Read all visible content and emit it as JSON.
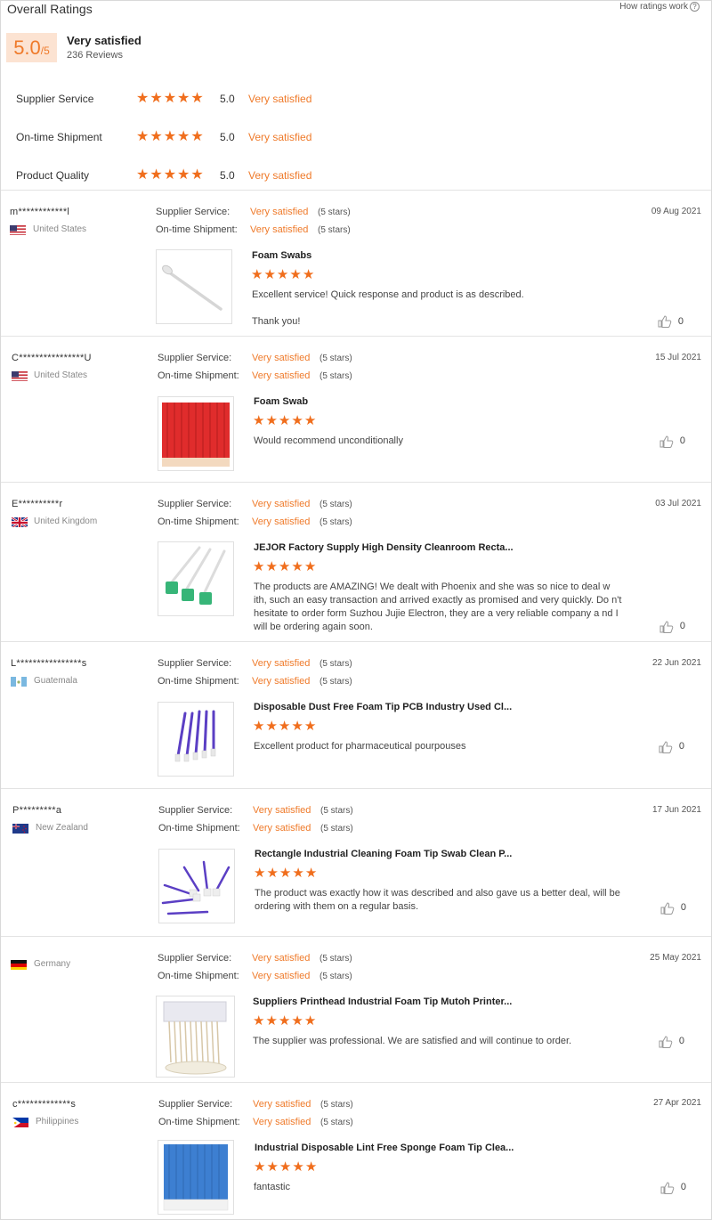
{
  "header": {
    "title": "Overall Ratings",
    "how_link": "How ratings work",
    "how_icon": "help-circle-icon",
    "score": "5.0",
    "score_max": "/5",
    "overall_label": "Very satisfied",
    "review_count": "236 Reviews"
  },
  "categories": [
    {
      "name": "Supplier Service",
      "rating": 5,
      "score": "5.0",
      "label": "Very satisfied"
    },
    {
      "name": "On-time Shipment",
      "rating": 5,
      "score": "5.0",
      "label": "Very satisfied"
    },
    {
      "name": "Product Quality",
      "rating": 5,
      "score": "5.0",
      "label": "Very satisfied"
    }
  ],
  "labels": {
    "supplier_service": "Supplier Service:",
    "on_time_shipment": "On-time Shipment:"
  },
  "reviews": [
    {
      "name": "m************l",
      "country": "United States",
      "flag": "us-flag-icon",
      "date": "09 Aug 2021",
      "supplier_value": "Very satisfied",
      "supplier_stars": "(5 stars)",
      "ontime_value": "Very satisfied",
      "ontime_stars": "(5 stars)",
      "product_title": "Foam Swabs",
      "rating": 5,
      "comment": "Excellent service!  Quick response and product is as described.",
      "comment2": "Thank you!",
      "likes": "0",
      "thumb": "single-foam-swab-image"
    },
    {
      "name": "C****************U",
      "country": "United States",
      "flag": "us-flag-icon",
      "date": "15 Jul 2021",
      "supplier_value": "Very satisfied",
      "supplier_stars": "(5 stars)",
      "ontime_value": "Very satisfied",
      "ontime_stars": "(5 stars)",
      "product_title": "Foam Swab",
      "rating": 5,
      "comment": "Would recommend unconditionally",
      "comment2": "",
      "likes": "0",
      "thumb": "red-swabs-bundle-image"
    },
    {
      "name": "E**********r",
      "country": "United Kingdom",
      "flag": "uk-flag-icon",
      "date": "03 Jul 2021",
      "supplier_value": "Very satisfied",
      "supplier_stars": "(5 stars)",
      "ontime_value": "Very satisfied",
      "ontime_stars": "(5 stars)",
      "product_title": "JEJOR Factory Supply High Density Cleanroom Recta...",
      "rating": 5,
      "comment": "The products are AMAZING! We dealt with Phoenix and she was so nice to deal w ith, such an easy transaction and arrived exactly as promised and very quickly. Do n't hesitate to order form Suzhou Jujie Electron, they are a very reliable company a nd I will be ordering again soon.",
      "comment2": "",
      "likes": "0",
      "thumb": "green-tip-swabs-image"
    },
    {
      "name": "L****************s",
      "country": "Guatemala",
      "flag": "guatemala-flag-icon",
      "date": "22 Jun 2021",
      "supplier_value": "Very satisfied",
      "supplier_stars": "(5 stars)",
      "ontime_value": "Very satisfied",
      "ontime_stars": "(5 stars)",
      "product_title": "Disposable Dust Free Foam Tip PCB Industry Used Cl...",
      "rating": 5,
      "comment": "Excellent product for pharmaceutical pourpouses",
      "comment2": "",
      "likes": "0",
      "thumb": "purple-swabs-image"
    },
    {
      "name": "P*********a",
      "country": "New Zealand",
      "flag": "new-zealand-flag-icon",
      "date": "17 Jun 2021",
      "supplier_value": "Very satisfied",
      "supplier_stars": "(5 stars)",
      "ontime_value": "Very satisfied",
      "ontime_stars": "(5 stars)",
      "product_title": "Rectangle Industrial Cleaning Foam Tip Swab Clean P...",
      "rating": 5,
      "comment": "The product was exactly how it was described and also gave us a better deal, will be ordering with them on a regular basis.",
      "comment2": "",
      "likes": "0",
      "thumb": "fanned-purple-swabs-image"
    },
    {
      "name": "",
      "country": "Germany",
      "flag": "germany-flag-icon",
      "date": "25 May 2021",
      "supplier_value": "Very satisfied",
      "supplier_stars": "(5 stars)",
      "ontime_value": "Very satisfied",
      "ontime_stars": "(5 stars)",
      "product_title": "Suppliers Printhead Industrial Foam Tip Mutoh Printer...",
      "rating": 5,
      "comment": "The supplier was professional. We are satisfied and will continue to order.",
      "comment2": "",
      "likes": "0",
      "thumb": "bagged-white-swabs-image"
    },
    {
      "name": "c*************s",
      "country": "Philippines",
      "flag": "philippines-flag-icon",
      "date": "27 Apr 2021",
      "supplier_value": "Very satisfied",
      "supplier_stars": "(5 stars)",
      "ontime_value": "Very satisfied",
      "ontime_stars": "(5 stars)",
      "product_title": "Industrial Disposable Lint Free Sponge Foam Tip Clea...",
      "rating": 5,
      "comment": "fantastic",
      "comment2": "",
      "likes": "0",
      "thumb": "blue-swabs-bundle-image"
    }
  ]
}
